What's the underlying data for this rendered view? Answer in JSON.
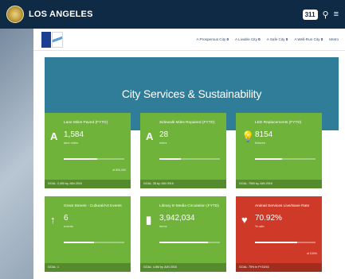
{
  "citybar": {
    "name": "LOS ANGELES",
    "badge": "311"
  },
  "subnav": {
    "links": [
      {
        "text": "A Prosperous City",
        "count": "0"
      },
      {
        "text": "A Livable City",
        "count": "0"
      },
      {
        "text": "A Safe City",
        "count": "0"
      },
      {
        "text": "A Well-Run City",
        "count": "0"
      },
      {
        "text": "Metro",
        "count": ""
      }
    ]
  },
  "hero": {
    "title": "City Services & Sustainability",
    "color": "#2f7d98"
  },
  "tiles": [
    {
      "title": "Lane Miles Paved (FYTD)",
      "icon": "road-icon",
      "value": "1,584",
      "sub": "lane miles",
      "bar_fraction": 0.55,
      "right": "of 800,000",
      "footer": "GOAL: 2,400 by JUN 2016",
      "color": "#6fb33a"
    },
    {
      "title": "Sidewalk Miles Repaired (FYTD)",
      "icon": "sidewalk-icon",
      "value": "28",
      "sub": "miles",
      "bar_fraction": 0.35,
      "right": "",
      "footer": "GOAL: 35 by JUN 2016",
      "color": "#6fb33a"
    },
    {
      "title": "LED Replacements (FYTD)",
      "icon": "lightbulb-icon",
      "value": "8154",
      "sub": "fixtures",
      "bar_fraction": 0.45,
      "right": "",
      "footer": "GOAL: 7500 by JUN 2016",
      "color": "#6fb33a"
    },
    {
      "title": "Great Streets - Cultural/Art Events",
      "icon": "arrow-up-icon",
      "value": "6",
      "sub": "events",
      "bar_fraction": 0.5,
      "right": "",
      "footer": "GOAL: 1",
      "color": "#6fb33a"
    },
    {
      "title": "Library E-Media Circulation (FYTD)",
      "icon": "tablet-icon",
      "value": "3,942,034",
      "sub": "items",
      "bar_fraction": 0.8,
      "right": "",
      "footer": "GOAL: 4.8M by JUN 2016",
      "color": "#6fb33a"
    },
    {
      "title": "Animal Services Live/Save Rate",
      "icon": "heart-icon",
      "value": "70.92%",
      "sub": "% rate",
      "bar_fraction": 0.7,
      "right": "of 100%",
      "footer": "GOAL: 75% in FY15/16",
      "color": "#cf3a28"
    }
  ]
}
